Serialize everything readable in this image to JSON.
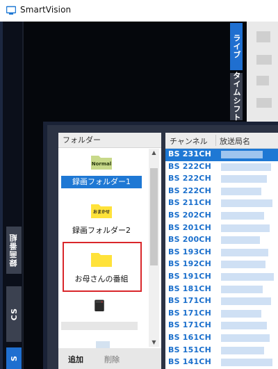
{
  "window": {
    "title": "SmartVision"
  },
  "tabs": {
    "live": "ライブ",
    "timeshift": "タイムシフト",
    "recorded": "録画番組",
    "cs": "CS",
    "s": "S"
  },
  "folder_panel": {
    "header": "フォルダー",
    "folders": [
      {
        "label": "録画フォルダー1",
        "badge": "Normal",
        "selected": true
      },
      {
        "label": "録画フォルダー2",
        "badge": "おまかせ",
        "selected": false
      },
      {
        "label": "お母さんの番組",
        "badge": "",
        "selected": false
      }
    ],
    "add_button": "追加",
    "delete_button": "削除"
  },
  "channel_panel": {
    "col_channel": "チャンネル",
    "col_station": "放送局名",
    "rows": [
      {
        "code": "BS 231CH",
        "selected": true
      },
      {
        "code": "BS 222CH",
        "selected": false
      },
      {
        "code": "BS 222CH",
        "selected": false
      },
      {
        "code": "BS 222CH",
        "selected": false
      },
      {
        "code": "BS 211CH",
        "selected": false
      },
      {
        "code": "BS 202CH",
        "selected": false
      },
      {
        "code": "BS 201CH",
        "selected": false
      },
      {
        "code": "BS 200CH",
        "selected": false
      },
      {
        "code": "BS 193CH",
        "selected": false
      },
      {
        "code": "BS 192CH",
        "selected": false
      },
      {
        "code": "BS 191CH",
        "selected": false
      },
      {
        "code": "BS 181CH",
        "selected": false
      },
      {
        "code": "BS 171CH",
        "selected": false
      },
      {
        "code": "BS 171CH",
        "selected": false
      },
      {
        "code": "BS 171CH",
        "selected": false
      },
      {
        "code": "BS 161CH",
        "selected": false
      },
      {
        "code": "BS 151CH",
        "selected": false
      },
      {
        "code": "BS 141CH",
        "selected": false
      }
    ]
  },
  "colors": {
    "accent_blue": "#1e78d4",
    "highlight_red": "#d9262a",
    "channel_text": "#1a6fcc"
  }
}
